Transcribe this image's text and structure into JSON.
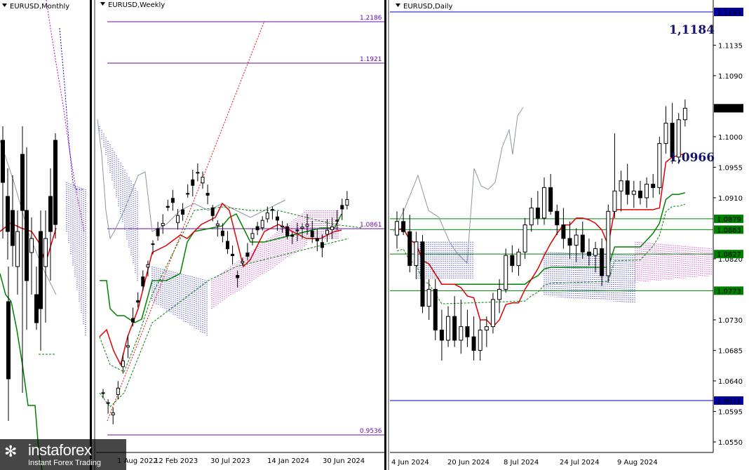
{
  "colors": {
    "kijun": "#008000",
    "tenkan": "#e00000",
    "chikou": "#8c96a6",
    "kumo_up": "#0000cc",
    "kumo_down": "#cc00cc",
    "level": "#6a0dad",
    "blue_level": "#0000cc",
    "green_level": "#008000",
    "candle": "#000000",
    "label_bg_blue": "#0000a0",
    "label_bg_green": "#008000",
    "label_bg_black": "#000000"
  },
  "monthly": {
    "title": "EURUSD,Monthly"
  },
  "weekly": {
    "title": "EURUSD,Weekly",
    "levels": [
      {
        "value": "1.2186"
      },
      {
        "value": "1.1921"
      },
      {
        "value": "1.0861"
      },
      {
        "value": "0.9536"
      }
    ],
    "x_labels": [
      "1 Aug 2022",
      "12 Feb 2023",
      "30 Jul 2023",
      "14 Jan 2024",
      "30 Jun 2024"
    ]
  },
  "daily": {
    "title": "EURUSD,Daily",
    "annotations": [
      "1,1184",
      "1,0966"
    ],
    "price_ticks": [
      "1.1135",
      "1.1090",
      "1.1000",
      "1.0955",
      "1.0910",
      "1.0820",
      "1.0730",
      "1.0685",
      "1.0640",
      "1.0595",
      "1.0550"
    ],
    "price_labels": [
      {
        "value": "1.1184",
        "style": "blue"
      },
      {
        "value": "1.1042",
        "style": "black"
      },
      {
        "value": "1.0879",
        "style": "green"
      },
      {
        "value": "1.0863",
        "style": "green"
      },
      {
        "value": "1.0827",
        "style": "green"
      },
      {
        "value": "1.0773",
        "style": "green"
      },
      {
        "value": "1.0611",
        "style": "blue"
      }
    ],
    "x_labels": [
      "4 Jun 2024",
      "20 Jun 2024",
      "8 Jul 2024",
      "24 Jul 2024",
      "9 Aug 2024"
    ]
  },
  "logo": {
    "name": "instaforex",
    "tagline": "Instant Forex Trading"
  },
  "chart_data": [
    {
      "type": "candlestick",
      "title": "EURUSD,Monthly",
      "indicators": [
        "Ichimoku Kinko Hyo"
      ]
    },
    {
      "type": "candlestick",
      "title": "EURUSD,Weekly",
      "indicators": [
        "Ichimoku Kinko Hyo"
      ],
      "horizontal_levels": [
        1.2186,
        1.1921,
        1.0861,
        0.9536
      ],
      "x_tick_labels": [
        "1 Aug 2022",
        "12 Feb 2023",
        "30 Jul 2023",
        "14 Jan 2024",
        "30 Jun 2024"
      ]
    },
    {
      "type": "candlestick",
      "title": "EURUSD,Daily",
      "indicators": [
        "Ichimoku Kinko Hyo"
      ],
      "ylim": [
        1.0535,
        1.1195
      ],
      "y_tick_labels": [
        1.1135,
        1.109,
        1.1,
        1.0955,
        1.091,
        1.082,
        1.073,
        1.0685,
        1.064,
        1.0595,
        1.055
      ],
      "horizontal_levels": [
        1.1184,
        1.0879,
        1.0863,
        1.0827,
        1.0773,
        1.0611
      ],
      "last_price": 1.1042,
      "annotations": [
        "1,1184",
        "1,0966"
      ],
      "x_tick_labels": [
        "4 Jun 2024",
        "20 Jun 2024",
        "8 Jul 2024",
        "24 Jul 2024",
        "9 Aug 2024"
      ],
      "candles": [
        {
          "o": 1.0855,
          "h": 1.089,
          "l": 1.0835,
          "c": 1.0875
        },
        {
          "o": 1.0875,
          "h": 1.0895,
          "l": 1.0855,
          "c": 1.086
        },
        {
          "o": 1.086,
          "h": 1.0885,
          "l": 1.08,
          "c": 1.081
        },
        {
          "o": 1.081,
          "h": 1.086,
          "l": 1.079,
          "c": 1.0845
        },
        {
          "o": 1.0845,
          "h": 1.0855,
          "l": 1.074,
          "c": 1.075
        },
        {
          "o": 1.075,
          "h": 1.079,
          "l": 1.073,
          "c": 1.0775
        },
        {
          "o": 1.0775,
          "h": 1.079,
          "l": 1.07,
          "c": 1.0715
        },
        {
          "o": 1.0715,
          "h": 1.0745,
          "l": 1.067,
          "c": 1.07
        },
        {
          "o": 1.07,
          "h": 1.075,
          "l": 1.069,
          "c": 1.0735
        },
        {
          "o": 1.0735,
          "h": 1.0765,
          "l": 1.069,
          "c": 1.07
        },
        {
          "o": 1.07,
          "h": 1.076,
          "l": 1.068,
          "c": 1.072
        },
        {
          "o": 1.072,
          "h": 1.0745,
          "l": 1.069,
          "c": 1.0705
        },
        {
          "o": 1.0705,
          "h": 1.0735,
          "l": 1.067,
          "c": 1.0685
        },
        {
          "o": 1.0685,
          "h": 1.073,
          "l": 1.067,
          "c": 1.0715
        },
        {
          "o": 1.0715,
          "h": 1.0735,
          "l": 1.069,
          "c": 1.072
        },
        {
          "o": 1.072,
          "h": 1.077,
          "l": 1.071,
          "c": 1.076
        },
        {
          "o": 1.076,
          "h": 1.079,
          "l": 1.074,
          "c": 1.0775
        },
        {
          "o": 1.0775,
          "h": 1.0835,
          "l": 1.077,
          "c": 1.0825
        },
        {
          "o": 1.0825,
          "h": 1.084,
          "l": 1.08,
          "c": 1.081
        },
        {
          "o": 1.081,
          "h": 1.0835,
          "l": 1.0795,
          "c": 1.083
        },
        {
          "o": 1.083,
          "h": 1.088,
          "l": 1.082,
          "c": 1.087
        },
        {
          "o": 1.087,
          "h": 1.091,
          "l": 1.086,
          "c": 1.0895
        },
        {
          "o": 1.0895,
          "h": 1.092,
          "l": 1.087,
          "c": 1.088
        },
        {
          "o": 1.088,
          "h": 1.094,
          "l": 1.087,
          "c": 1.0925
        },
        {
          "o": 1.0925,
          "h": 1.0945,
          "l": 1.0885,
          "c": 1.089
        },
        {
          "o": 1.089,
          "h": 1.09,
          "l": 1.0855,
          "c": 1.087
        },
        {
          "o": 1.087,
          "h": 1.0895,
          "l": 1.0835,
          "c": 1.085
        },
        {
          "o": 1.085,
          "h": 1.0875,
          "l": 1.082,
          "c": 1.084
        },
        {
          "o": 1.084,
          "h": 1.0865,
          "l": 1.0815,
          "c": 1.0855
        },
        {
          "o": 1.0855,
          "h": 1.0875,
          "l": 1.082,
          "c": 1.083
        },
        {
          "o": 1.083,
          "h": 1.085,
          "l": 1.081,
          "c": 1.0825
        },
        {
          "o": 1.0825,
          "h": 1.0845,
          "l": 1.08,
          "c": 1.0835
        },
        {
          "o": 1.0835,
          "h": 1.085,
          "l": 1.078,
          "c": 1.0795
        },
        {
          "o": 1.0795,
          "h": 1.09,
          "l": 1.0785,
          "c": 1.089
        },
        {
          "o": 1.089,
          "h": 1.1005,
          "l": 1.088,
          "c": 1.092
        },
        {
          "o": 1.092,
          "h": 1.095,
          "l": 1.089,
          "c": 1.0935
        },
        {
          "o": 1.0935,
          "h": 1.096,
          "l": 1.09,
          "c": 1.0915
        },
        {
          "o": 1.0915,
          "h": 1.0935,
          "l": 1.0895,
          "c": 1.092
        },
        {
          "o": 1.092,
          "h": 1.0935,
          "l": 1.09,
          "c": 1.091
        },
        {
          "o": 1.091,
          "h": 1.094,
          "l": 1.0895,
          "c": 1.093
        },
        {
          "o": 1.093,
          "h": 1.0945,
          "l": 1.091,
          "c": 1.0925
        },
        {
          "o": 1.0925,
          "h": 1.1,
          "l": 1.0915,
          "c": 1.099
        },
        {
          "o": 1.099,
          "h": 1.1045,
          "l": 1.0975,
          "c": 1.102
        },
        {
          "o": 1.102,
          "h": 1.105,
          "l": 1.096,
          "c": 1.097
        },
        {
          "o": 1.097,
          "h": 1.1035,
          "l": 1.096,
          "c": 1.1025
        },
        {
          "o": 1.1025,
          "h": 1.1055,
          "l": 1.1015,
          "c": 1.1042
        }
      ]
    }
  ]
}
